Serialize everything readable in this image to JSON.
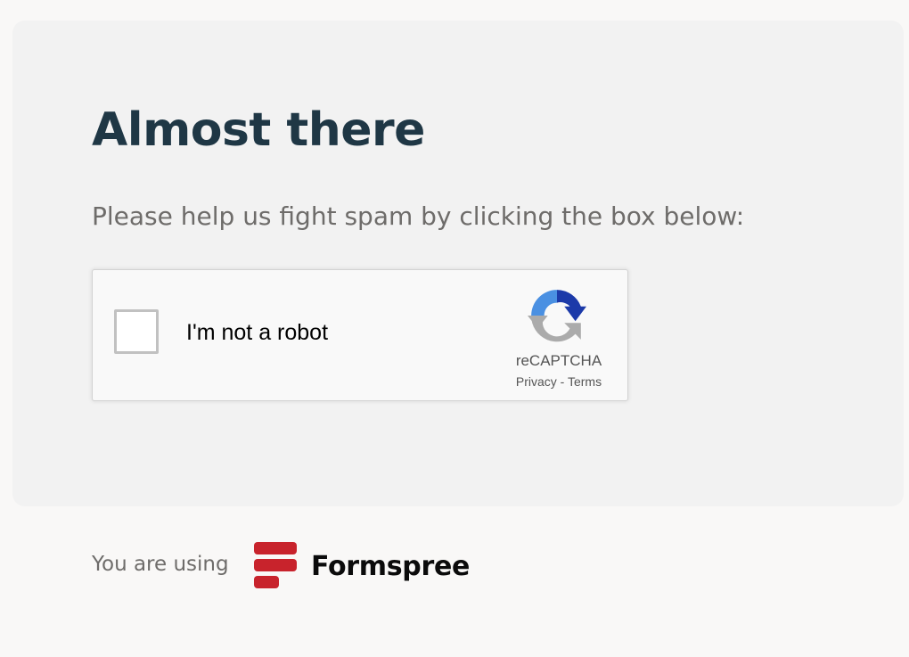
{
  "card": {
    "title": "Almost there",
    "subtitle": "Please help us fight spam by clicking the box below:"
  },
  "recaptcha": {
    "checkbox_label": "I'm not a robot",
    "checked": false,
    "brand": "reCAPTCHA",
    "privacy_link": "Privacy",
    "separator": " - ",
    "terms_link": "Terms",
    "logo_icon": "recaptcha-logo-icon"
  },
  "footer": {
    "text": "You are using",
    "brand_name": "Formspree",
    "brand_color": "#c8232c"
  }
}
